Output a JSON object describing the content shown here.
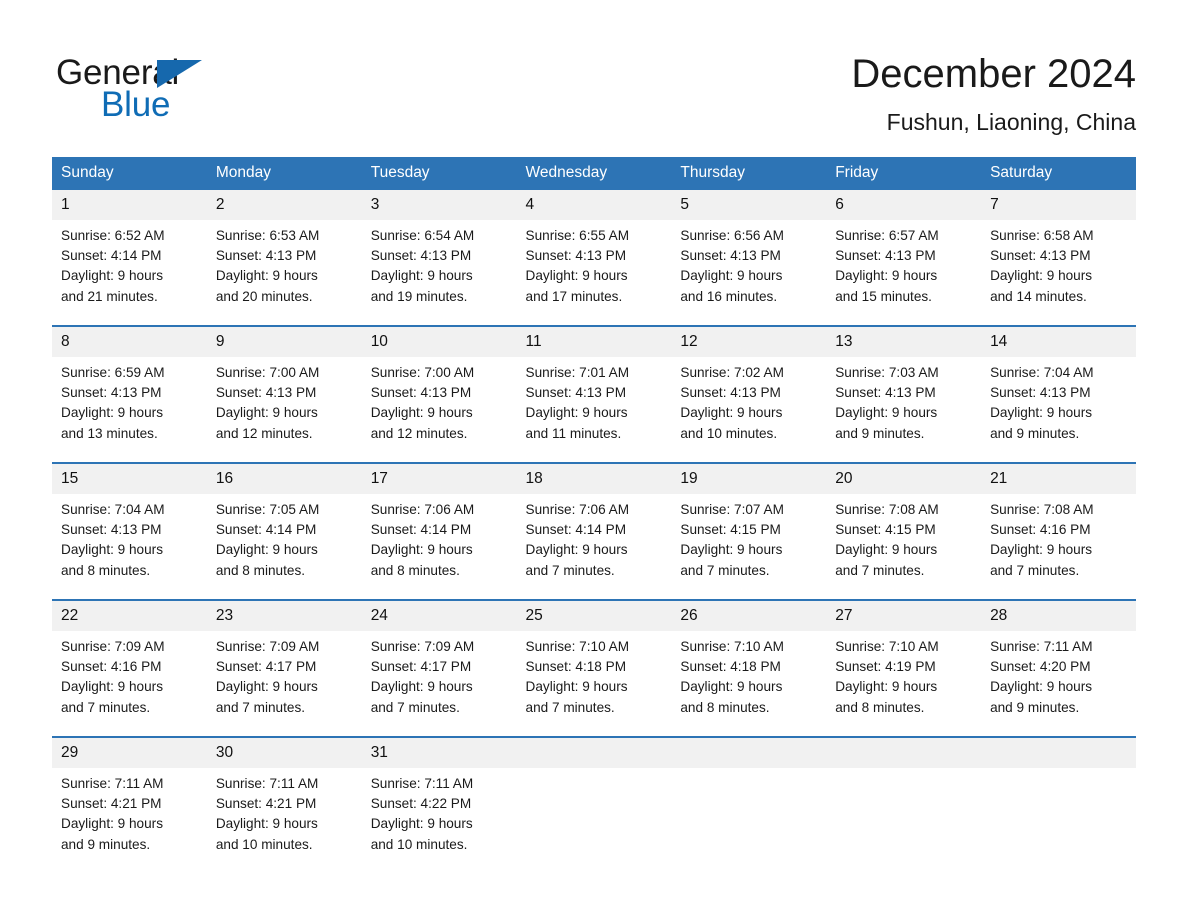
{
  "brand": {
    "name_top": "General",
    "name_bottom": "Blue",
    "color_black": "#1a1a1a",
    "color_blue": "#0f6cb5",
    "triangle_color": "#1668ad"
  },
  "header": {
    "title": "December 2024",
    "subtitle": "Fushun, Liaoning, China"
  },
  "theme": {
    "header_blue": "#2d74b5",
    "daynum_gray": "#f1f1f1",
    "text": "#1a1a1a"
  },
  "weekday_headers": [
    "Sunday",
    "Monday",
    "Tuesday",
    "Wednesday",
    "Thursday",
    "Friday",
    "Saturday"
  ],
  "weeks": [
    [
      {
        "day": "1",
        "sunrise": "Sunrise: 6:52 AM",
        "sunset": "Sunset: 4:14 PM",
        "daylight_line1": "Daylight: 9 hours",
        "daylight_line2": "and 21 minutes."
      },
      {
        "day": "2",
        "sunrise": "Sunrise: 6:53 AM",
        "sunset": "Sunset: 4:13 PM",
        "daylight_line1": "Daylight: 9 hours",
        "daylight_line2": "and 20 minutes."
      },
      {
        "day": "3",
        "sunrise": "Sunrise: 6:54 AM",
        "sunset": "Sunset: 4:13 PM",
        "daylight_line1": "Daylight: 9 hours",
        "daylight_line2": "and 19 minutes."
      },
      {
        "day": "4",
        "sunrise": "Sunrise: 6:55 AM",
        "sunset": "Sunset: 4:13 PM",
        "daylight_line1": "Daylight: 9 hours",
        "daylight_line2": "and 17 minutes."
      },
      {
        "day": "5",
        "sunrise": "Sunrise: 6:56 AM",
        "sunset": "Sunset: 4:13 PM",
        "daylight_line1": "Daylight: 9 hours",
        "daylight_line2": "and 16 minutes."
      },
      {
        "day": "6",
        "sunrise": "Sunrise: 6:57 AM",
        "sunset": "Sunset: 4:13 PM",
        "daylight_line1": "Daylight: 9 hours",
        "daylight_line2": "and 15 minutes."
      },
      {
        "day": "7",
        "sunrise": "Sunrise: 6:58 AM",
        "sunset": "Sunset: 4:13 PM",
        "daylight_line1": "Daylight: 9 hours",
        "daylight_line2": "and 14 minutes."
      }
    ],
    [
      {
        "day": "8",
        "sunrise": "Sunrise: 6:59 AM",
        "sunset": "Sunset: 4:13 PM",
        "daylight_line1": "Daylight: 9 hours",
        "daylight_line2": "and 13 minutes."
      },
      {
        "day": "9",
        "sunrise": "Sunrise: 7:00 AM",
        "sunset": "Sunset: 4:13 PM",
        "daylight_line1": "Daylight: 9 hours",
        "daylight_line2": "and 12 minutes."
      },
      {
        "day": "10",
        "sunrise": "Sunrise: 7:00 AM",
        "sunset": "Sunset: 4:13 PM",
        "daylight_line1": "Daylight: 9 hours",
        "daylight_line2": "and 12 minutes."
      },
      {
        "day": "11",
        "sunrise": "Sunrise: 7:01 AM",
        "sunset": "Sunset: 4:13 PM",
        "daylight_line1": "Daylight: 9 hours",
        "daylight_line2": "and 11 minutes."
      },
      {
        "day": "12",
        "sunrise": "Sunrise: 7:02 AM",
        "sunset": "Sunset: 4:13 PM",
        "daylight_line1": "Daylight: 9 hours",
        "daylight_line2": "and 10 minutes."
      },
      {
        "day": "13",
        "sunrise": "Sunrise: 7:03 AM",
        "sunset": "Sunset: 4:13 PM",
        "daylight_line1": "Daylight: 9 hours",
        "daylight_line2": "and 9 minutes."
      },
      {
        "day": "14",
        "sunrise": "Sunrise: 7:04 AM",
        "sunset": "Sunset: 4:13 PM",
        "daylight_line1": "Daylight: 9 hours",
        "daylight_line2": "and 9 minutes."
      }
    ],
    [
      {
        "day": "15",
        "sunrise": "Sunrise: 7:04 AM",
        "sunset": "Sunset: 4:13 PM",
        "daylight_line1": "Daylight: 9 hours",
        "daylight_line2": "and 8 minutes."
      },
      {
        "day": "16",
        "sunrise": "Sunrise: 7:05 AM",
        "sunset": "Sunset: 4:14 PM",
        "daylight_line1": "Daylight: 9 hours",
        "daylight_line2": "and 8 minutes."
      },
      {
        "day": "17",
        "sunrise": "Sunrise: 7:06 AM",
        "sunset": "Sunset: 4:14 PM",
        "daylight_line1": "Daylight: 9 hours",
        "daylight_line2": "and 8 minutes."
      },
      {
        "day": "18",
        "sunrise": "Sunrise: 7:06 AM",
        "sunset": "Sunset: 4:14 PM",
        "daylight_line1": "Daylight: 9 hours",
        "daylight_line2": "and 7 minutes."
      },
      {
        "day": "19",
        "sunrise": "Sunrise: 7:07 AM",
        "sunset": "Sunset: 4:15 PM",
        "daylight_line1": "Daylight: 9 hours",
        "daylight_line2": "and 7 minutes."
      },
      {
        "day": "20",
        "sunrise": "Sunrise: 7:08 AM",
        "sunset": "Sunset: 4:15 PM",
        "daylight_line1": "Daylight: 9 hours",
        "daylight_line2": "and 7 minutes."
      },
      {
        "day": "21",
        "sunrise": "Sunrise: 7:08 AM",
        "sunset": "Sunset: 4:16 PM",
        "daylight_line1": "Daylight: 9 hours",
        "daylight_line2": "and 7 minutes."
      }
    ],
    [
      {
        "day": "22",
        "sunrise": "Sunrise: 7:09 AM",
        "sunset": "Sunset: 4:16 PM",
        "daylight_line1": "Daylight: 9 hours",
        "daylight_line2": "and 7 minutes."
      },
      {
        "day": "23",
        "sunrise": "Sunrise: 7:09 AM",
        "sunset": "Sunset: 4:17 PM",
        "daylight_line1": "Daylight: 9 hours",
        "daylight_line2": "and 7 minutes."
      },
      {
        "day": "24",
        "sunrise": "Sunrise: 7:09 AM",
        "sunset": "Sunset: 4:17 PM",
        "daylight_line1": "Daylight: 9 hours",
        "daylight_line2": "and 7 minutes."
      },
      {
        "day": "25",
        "sunrise": "Sunrise: 7:10 AM",
        "sunset": "Sunset: 4:18 PM",
        "daylight_line1": "Daylight: 9 hours",
        "daylight_line2": "and 7 minutes."
      },
      {
        "day": "26",
        "sunrise": "Sunrise: 7:10 AM",
        "sunset": "Sunset: 4:18 PM",
        "daylight_line1": "Daylight: 9 hours",
        "daylight_line2": "and 8 minutes."
      },
      {
        "day": "27",
        "sunrise": "Sunrise: 7:10 AM",
        "sunset": "Sunset: 4:19 PM",
        "daylight_line1": "Daylight: 9 hours",
        "daylight_line2": "and 8 minutes."
      },
      {
        "day": "28",
        "sunrise": "Sunrise: 7:11 AM",
        "sunset": "Sunset: 4:20 PM",
        "daylight_line1": "Daylight: 9 hours",
        "daylight_line2": "and 9 minutes."
      }
    ],
    [
      {
        "day": "29",
        "sunrise": "Sunrise: 7:11 AM",
        "sunset": "Sunset: 4:21 PM",
        "daylight_line1": "Daylight: 9 hours",
        "daylight_line2": "and 9 minutes."
      },
      {
        "day": "30",
        "sunrise": "Sunrise: 7:11 AM",
        "sunset": "Sunset: 4:21 PM",
        "daylight_line1": "Daylight: 9 hours",
        "daylight_line2": "and 10 minutes."
      },
      {
        "day": "31",
        "sunrise": "Sunrise: 7:11 AM",
        "sunset": "Sunset: 4:22 PM",
        "daylight_line1": "Daylight: 9 hours",
        "daylight_line2": "and 10 minutes."
      },
      {
        "day": "",
        "sunrise": "",
        "sunset": "",
        "daylight_line1": "",
        "daylight_line2": ""
      },
      {
        "day": "",
        "sunrise": "",
        "sunset": "",
        "daylight_line1": "",
        "daylight_line2": ""
      },
      {
        "day": "",
        "sunrise": "",
        "sunset": "",
        "daylight_line1": "",
        "daylight_line2": ""
      },
      {
        "day": "",
        "sunrise": "",
        "sunset": "",
        "daylight_line1": "",
        "daylight_line2": ""
      }
    ]
  ]
}
